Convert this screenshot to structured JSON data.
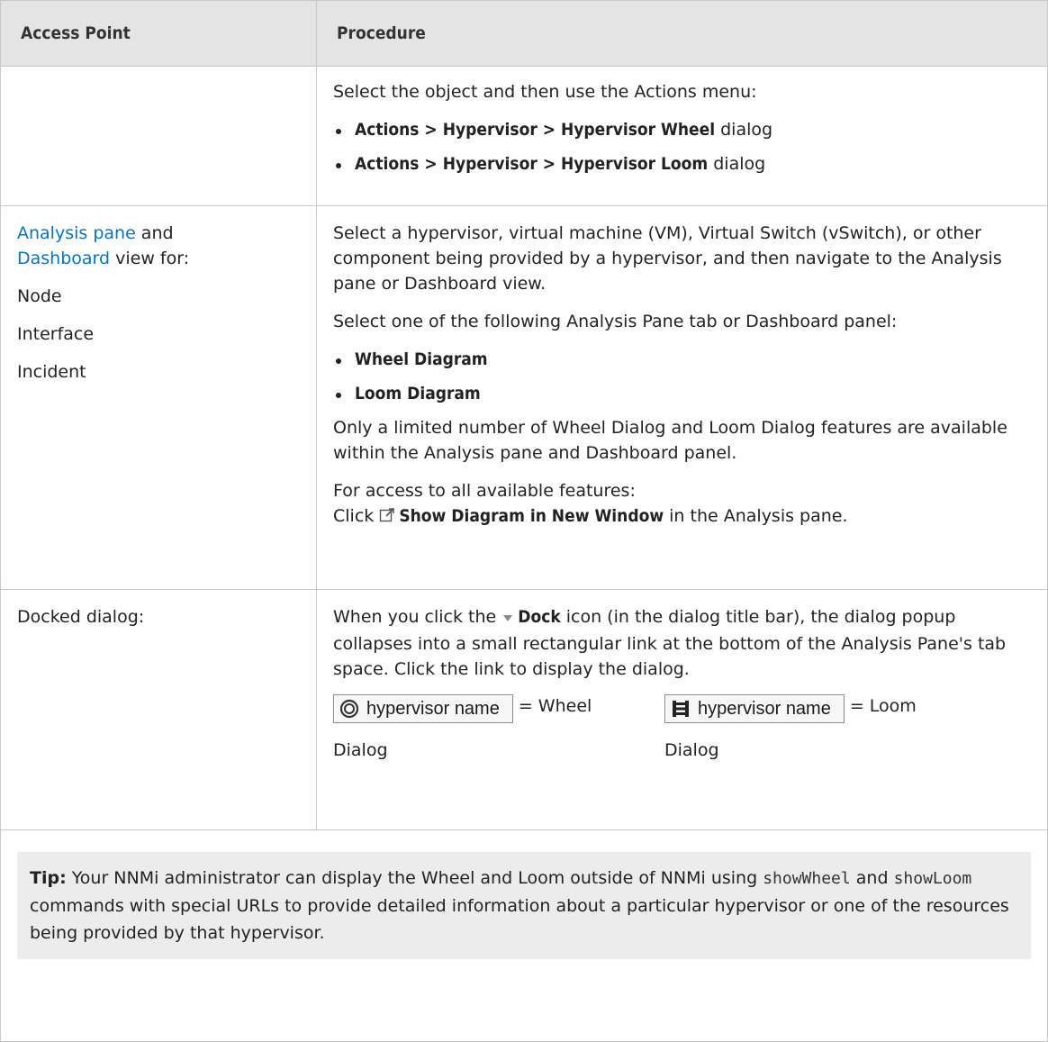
{
  "header": {
    "col_access": "Access Point",
    "col_procedure": "Procedure"
  },
  "row1": {
    "intro": "Select the object and then use the Actions menu:",
    "items": [
      {
        "path": "Actions > Hypervisor > Hypervisor Wheel",
        "suffix": " dialog"
      },
      {
        "path": "Actions > Hypervisor > Hypervisor Loom",
        "suffix": " dialog"
      }
    ]
  },
  "row2": {
    "access_link1": "Analysis pane",
    "access_and": " and",
    "access_link2": "Dashboard",
    "access_view": " view for:",
    "access_items": [
      "Node",
      "Interface",
      "Incident"
    ],
    "p1": "Select a hypervisor, virtual machine (VM), Virtual Switch (vSwitch), or other component being provided by a hypervisor, and then navigate to the Analysis pane or Dashboard view.",
    "p2": "Select one of the following Analysis Pane tab or Dashboard panel:",
    "bullets": [
      "Wheel Diagram",
      "Loom Diagram"
    ],
    "p3": "Only a limited number of Wheel Dialog and Loom Dialog features are available within the Analysis pane and Dashboard panel.",
    "p4a": "For access to all available features:",
    "p4b_click": "Click ",
    "p4b_bold": "Show Diagram in New Window",
    "p4b_suffix": " in the Analysis pane."
  },
  "row3": {
    "access": "Docked dialog:",
    "p_pre": "When you click the ",
    "p_bold": "Dock",
    "p_post": " icon (in the dialog title bar), the dialog popup collapses into a small rectangular link at the bottom of the Analysis Pane's tab space. Click the link to display the dialog.",
    "chips": [
      {
        "label": "hypervisor name",
        "eq": "= Wheel",
        "caption": "Dialog",
        "icon": "wheel-icon"
      },
      {
        "label": "hypervisor name",
        "eq": "= Loom",
        "caption": "Dialog",
        "icon": "loom-icon"
      }
    ]
  },
  "tip": {
    "label": "Tip:",
    "t1": " Your NNMi administrator can display the Wheel and Loom outside of NNMi using ",
    "cmd1": "showWheel",
    "t2": " and ",
    "cmd2": "showLoom",
    "t3": " commands with special URLs to provide detailed information about a particular hypervisor or one of the resources being provided by that hypervisor."
  },
  "colors": {
    "link": "#0a73b8",
    "header_bg": "#e4e4e4",
    "tip_bg": "#ececec",
    "border": "#c8c8c8"
  }
}
